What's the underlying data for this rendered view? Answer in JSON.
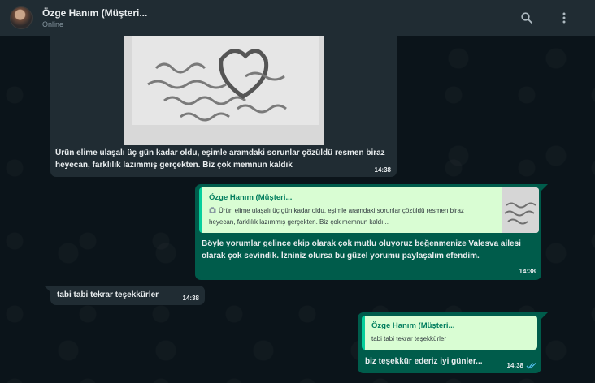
{
  "header": {
    "contact_name": "Özge Hanım (Müşteri...",
    "status": "Online"
  },
  "messages": [
    {
      "text": "Ürün elime ulaşalı üç gün kadar oldu, eşimle aramdaki sorunlar çözüldü resmen biraz heyecan, farklılık lazımmış gerçekten. Biz çok memnun kaldık",
      "time": "14:38"
    },
    {
      "quote_name": "Özge Hanım (Müşteri...",
      "quote_text": "Ürün elime ulaşalı üç gün kadar oldu, eşimle aramdaki sorunlar çözüldü resmen biraz heyecan, farklılık lazımmış gerçekten. Biz çok memnun kaldı...",
      "text": "Böyle yorumlar gelince ekip olarak çok mutlu oluyoruz beğenmenize Valesva ailesi olarak çok sevindik. İzniniz olursa bu güzel yorumu paylaşalım efendim.",
      "time": "14:38"
    },
    {
      "text": "tabi tabi tekrar teşekkürler",
      "time": "14:38"
    },
    {
      "quote_name": "Özge Hanım (Müşteri...",
      "quote_text": "tabi tabi tekrar teşekkürler",
      "text": "biz teşekkür ederiz iyi günler...",
      "time": "14:38"
    }
  ],
  "icons": {
    "search": "search-icon",
    "menu": "more-vertical-icon",
    "photo": "camera-icon",
    "read": "double-check-icon"
  },
  "colors": {
    "header_bg": "#202c33",
    "incoming_bg": "#202c33",
    "outgoing_bg": "#005c4b",
    "quote_bg": "#d9fdd3",
    "quote_accent": "#06cf9c",
    "read_tick": "#53bdeb"
  }
}
